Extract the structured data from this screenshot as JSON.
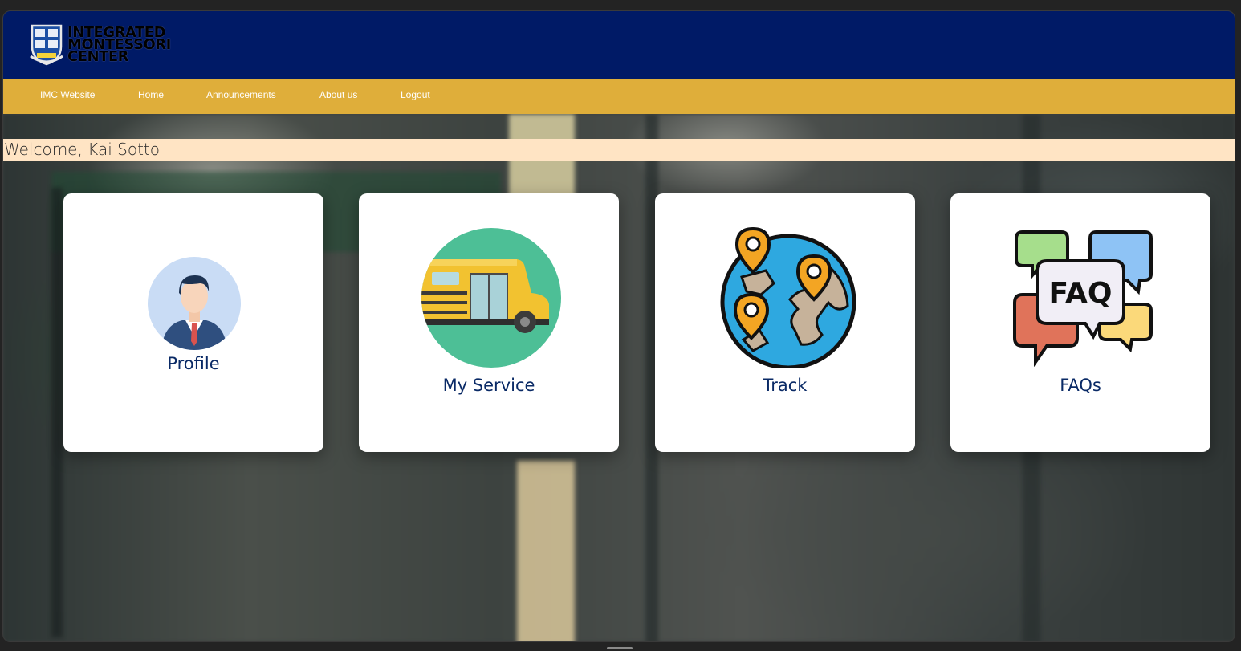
{
  "header": {
    "logo_lines": [
      "INTEGRATED",
      "MONTESSORI",
      "CENTER"
    ],
    "brand_color": "#001a66"
  },
  "nav": {
    "accent": "#dfae3a",
    "items": [
      {
        "label": "IMC Website"
      },
      {
        "label": "Home"
      },
      {
        "label": "Announcements"
      },
      {
        "label": "About us"
      },
      {
        "label": "Logout"
      }
    ]
  },
  "welcome": {
    "text": "Welcome, Kai Sotto"
  },
  "cards": [
    {
      "label": "Profile",
      "icon": "profile-icon"
    },
    {
      "label": "My Service",
      "icon": "school-bus-icon"
    },
    {
      "label": "Track",
      "icon": "globe-map-pin-icon"
    },
    {
      "label": "FAQs",
      "icon": "faq-chat-bubbles-icon"
    }
  ]
}
